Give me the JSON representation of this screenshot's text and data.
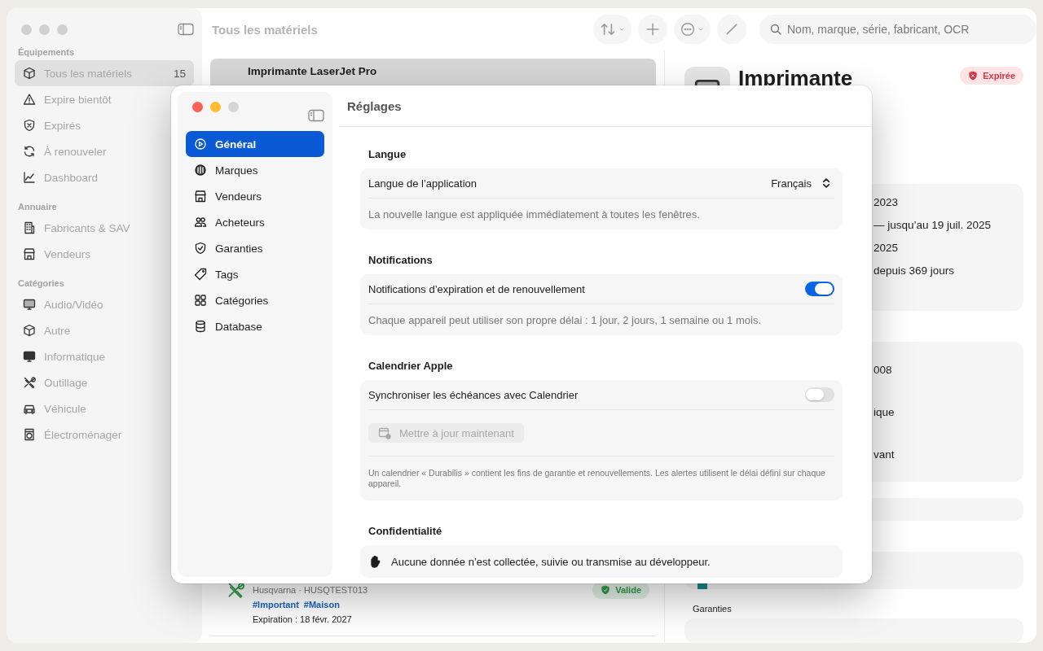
{
  "main_window": {
    "sidebar": {
      "sections": [
        {
          "title": "Équipements",
          "items": [
            {
              "label": "Tous les matériels",
              "count": "15",
              "selected": true
            },
            {
              "label": "Expire bientôt",
              "selected": false
            },
            {
              "label": "Expirés",
              "selected": false
            },
            {
              "label": "À renouveler",
              "selected": false
            },
            {
              "label": "Dashboard",
              "selected": false
            }
          ]
        },
        {
          "title": "Annuaire",
          "items": [
            {
              "label": "Fabricants & SAV",
              "selected": false
            },
            {
              "label": "Vendeurs",
              "selected": false
            }
          ]
        },
        {
          "title": "Catégories",
          "items": [
            {
              "label": "Audio/Vidéo",
              "selected": false
            },
            {
              "label": "Autre",
              "selected": false
            },
            {
              "label": "Informatique",
              "selected": false
            },
            {
              "label": "Outillage",
              "selected": false
            },
            {
              "label": "Véhicule",
              "selected": false
            },
            {
              "label": "Électroménager",
              "selected": false
            }
          ]
        }
      ]
    },
    "list": {
      "title": "Tous les matériels",
      "items": [
        {
          "title": "Imprimante LaserJet Pro",
          "selected": true
        },
        {
          "subtitle": "Husqvarna · HUSQTEST013",
          "tags": [
            "#Important",
            "#Maison"
          ],
          "expiration": "Expiration : 18 févr. 2027",
          "status": {
            "label": "Valide",
            "kind": "valid"
          },
          "selected": false
        }
      ]
    },
    "search": {
      "placeholder": "Nom, marque, série, fabricant, OCR"
    },
    "detail": {
      "title": "Imprimante",
      "status": {
        "label": "Expirée",
        "kind": "expired"
      },
      "card_1": [
        "2023",
        "— jusqu’au 19 juil. 2025",
        "2025",
        "depuis 369 jours"
      ],
      "card_2": [
        "008",
        "ique",
        "vant"
      ],
      "section_label": "Garanties"
    }
  },
  "settings": {
    "title": "Réglages",
    "nav": [
      {
        "label": "Général",
        "selected": true
      },
      {
        "label": "Marques",
        "selected": false
      },
      {
        "label": "Vendeurs",
        "selected": false
      },
      {
        "label": "Acheteurs",
        "selected": false
      },
      {
        "label": "Garanties",
        "selected": false
      },
      {
        "label": "Tags",
        "selected": false
      },
      {
        "label": "Catégories",
        "selected": false
      },
      {
        "label": "Database",
        "selected": false
      }
    ],
    "sections": [
      {
        "title": "Langue",
        "rows": [
          {
            "kind": "picker",
            "label": "Langue de l’application",
            "value": "Français"
          },
          {
            "kind": "note",
            "text": "La nouvelle langue est appliquée immédiatement à toutes les fenêtres."
          }
        ]
      },
      {
        "title": "Notifications",
        "rows": [
          {
            "kind": "toggle",
            "label": "Notifications d’expiration et de renouvellement",
            "on": true
          },
          {
            "kind": "note",
            "text": "Chaque appareil peut utiliser son propre délai : 1 jour, 2 jours, 1 semaine ou 1 mois."
          }
        ]
      },
      {
        "title": "Calendrier Apple",
        "rows": [
          {
            "kind": "toggle",
            "label": "Synchroniser les échéances avec Calendrier",
            "on": false
          },
          {
            "kind": "button",
            "label": "Mettre à jour maintenant",
            "disabled": true
          },
          {
            "kind": "footnote",
            "text": "Un calendrier « Durabilis » contient les fins de garantie et renouvellements. Les alertes utilisent le délai défini sur chaque appareil."
          }
        ]
      },
      {
        "title": "Confidentialité",
        "rows": [
          {
            "kind": "info",
            "text": "Aucune donnée n’est collectée, suivie ou transmise au développeur."
          }
        ]
      }
    ]
  }
}
